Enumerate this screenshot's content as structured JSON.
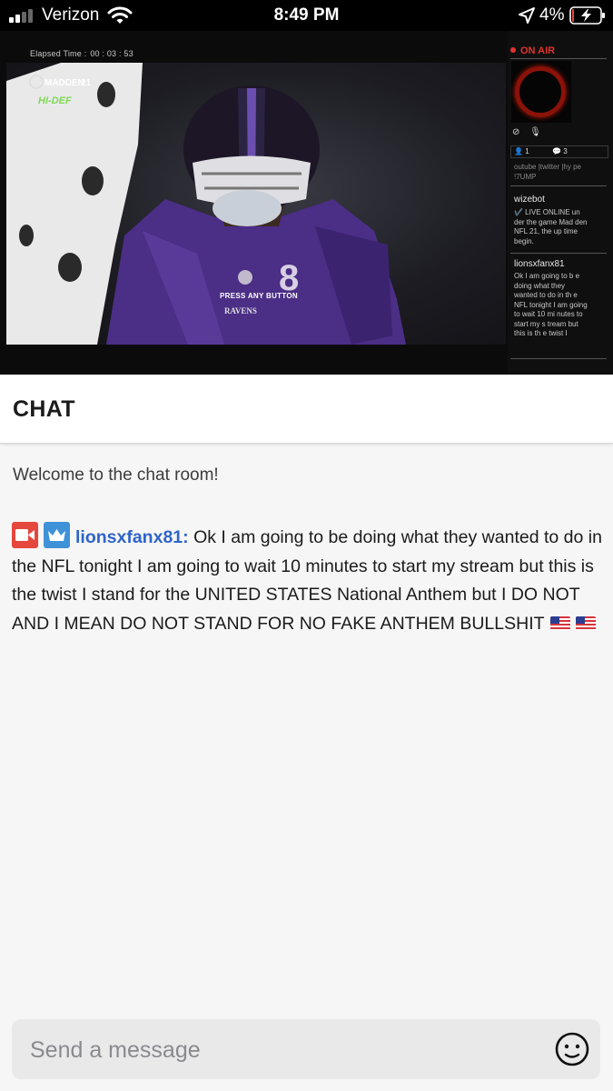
{
  "status_bar": {
    "carrier": "Verizon",
    "time": "8:49 PM",
    "battery_percent": "4%",
    "battery_level": 0.04,
    "signal_bars_active": 2,
    "signal_bars_total": 4
  },
  "stream": {
    "elapsed_label": "Elapsed Time :",
    "elapsed_value": "00 : 03 : 53",
    "game_prompt": "PRESS ANY BUTTON",
    "on_air_label": "ON AIR",
    "viewer_count": "1",
    "comment_count": "3",
    "side_chat": [
      {
        "name": "",
        "text": "outube |twitter |hy pe !7UMP"
      },
      {
        "name": "wizebot",
        "text": "✔️ LIVE ONLINE un der the game Mad den NFL 21, the up time begin."
      },
      {
        "name": "lionsxfanx81",
        "text": "Ok I am going to b e doing what they wanted to do in th e NFL tonight I am going to wait 10 mi nutes to start my s tream but this is th e twist I"
      }
    ]
  },
  "chat": {
    "title": "CHAT",
    "welcome": "Welcome to the chat room!",
    "messages": [
      {
        "username": "lionsxfanx81:",
        "text": "Ok I am going to be doing what they wanted to do in the NFL tonight I am going to wait 10 minutes to start my stream but this is the twist I stand for the UNITED STATES National Anthem but I DO NOT AND I MEAN DO NOT STAND FOR NO FAKE ANTHEM BULLSHIT",
        "badges": [
          "video-camera-icon",
          "crown-icon"
        ],
        "emoji": [
          "us-flag",
          "us-flag"
        ]
      }
    ],
    "input_placeholder": "Send a message"
  },
  "colors": {
    "username": "#2e64c8",
    "camera_badge": "#e5473d",
    "crown_badge": "#3f92d8",
    "on_air": "#e0332d"
  }
}
